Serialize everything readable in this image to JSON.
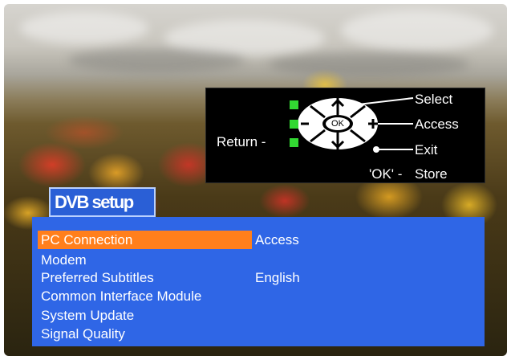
{
  "help": {
    "return_label": "Return -",
    "select_label": "Select",
    "access_label": "Access",
    "exit_label": "Exit",
    "ok_store_prefix": "'OK' -",
    "store_label": "Store",
    "ok_button_label": "OK",
    "plus_label": "+",
    "minus_label": "-",
    "color_green": "#32d832"
  },
  "menu": {
    "title": "DVB setup",
    "items": [
      {
        "label": "PC Connection",
        "value": "Access",
        "selected": true
      },
      {
        "label": "Modem",
        "value": ""
      },
      {
        "label": "Preferred Subtitles",
        "value": "English"
      },
      {
        "label": "Common Interface Module",
        "value": ""
      },
      {
        "label": "System Update",
        "value": ""
      },
      {
        "label": "Signal Quality",
        "value": ""
      }
    ],
    "colors": {
      "panel": "#2f66e6",
      "highlight": "#ff7f1c",
      "title_tab": "#2a5fd6"
    }
  }
}
